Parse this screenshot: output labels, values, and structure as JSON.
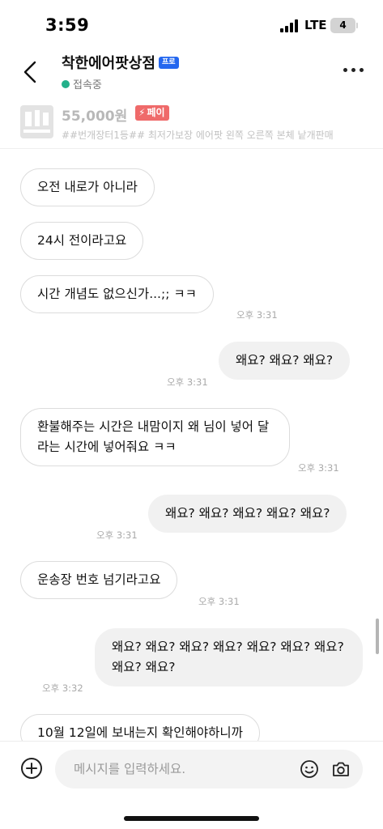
{
  "status_bar": {
    "time": "3:59",
    "network": "LTE",
    "battery_level": "4"
  },
  "header": {
    "shop_name": "착한에어팟상점",
    "badge": "프로",
    "online_status": "접속중",
    "online_color": "#23b08a",
    "back_icon": "chevron-left-icon",
    "more_icon": "more-horizontal-icon"
  },
  "product": {
    "price": "55,000원",
    "pay_label": "페이",
    "pay_color": "#ef6a6a",
    "title": "##번개장터1등## 최저가보장 에어팟 왼쪽 오른쪽 본체 낱개판매"
  },
  "messages": [
    {
      "side": "received",
      "text": "오전 내로가 아니라",
      "time": ""
    },
    {
      "side": "received",
      "text": "24시 전이라고요",
      "time": ""
    },
    {
      "side": "received",
      "text": "시간 개념도 없으신가...;; ㅋㅋ",
      "time": "오후 3:31"
    },
    {
      "side": "sent",
      "text": "왜요? 왜요? 왜요?",
      "time": "오후 3:31"
    },
    {
      "side": "received",
      "text": "환불해주는 시간은 내맘이지 왜 님이 넣어 달라는 시간에 넣어줘요 ㅋㅋ",
      "time": "오후 3:31"
    },
    {
      "side": "sent",
      "text": "왜요? 왜요? 왜요? 왜요? 왜요?",
      "time": "오후 3:31"
    },
    {
      "side": "received",
      "text": "운송장 번호 넘기라고요",
      "time": "오후 3:31"
    },
    {
      "side": "sent",
      "text": "왜요? 왜요? 왜요? 왜요? 왜요? 왜요? 왜요? 왜요? 왜요?",
      "time": "오후 3:32"
    },
    {
      "side": "received",
      "text": "10월 12일에 보내는지 확인해야하니까",
      "time": ""
    }
  ],
  "composer": {
    "placeholder": "메시지를 입력하세요.",
    "attach_icon": "plus-circle-icon",
    "emoji_icon": "smile-icon",
    "camera_icon": "camera-icon"
  }
}
